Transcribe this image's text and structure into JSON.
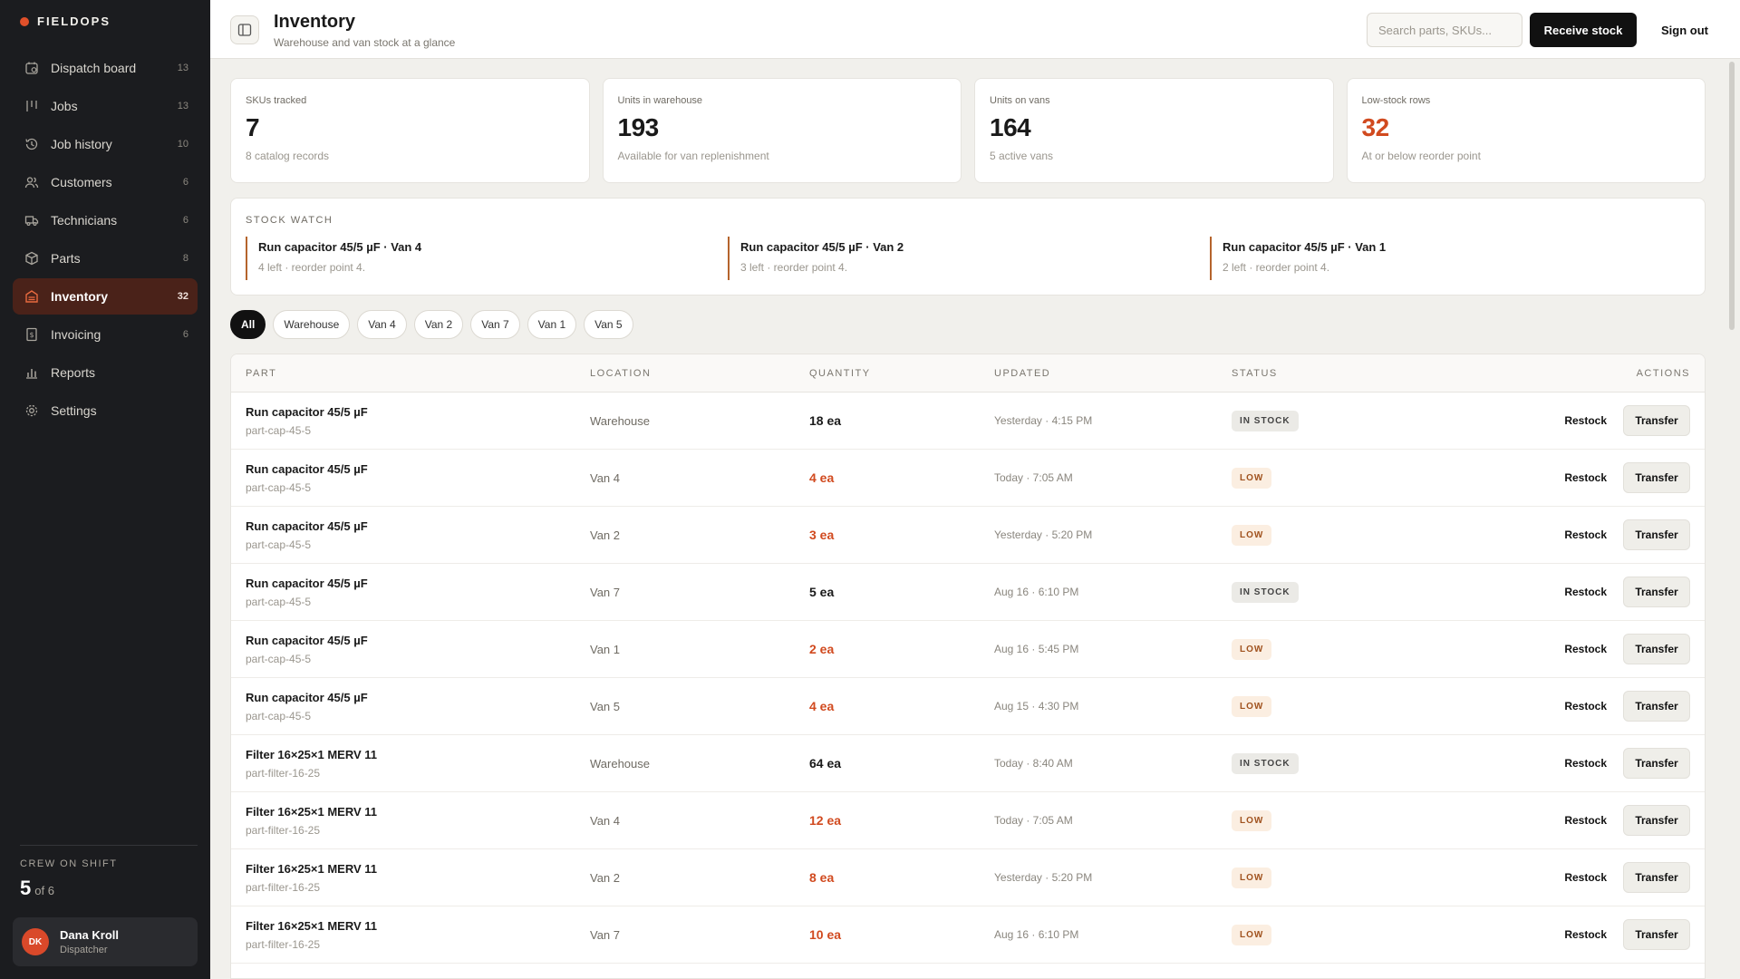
{
  "brand": {
    "name": "FIELDOPS"
  },
  "nav": [
    {
      "label": "Dispatch board",
      "count": "13",
      "icon": "dispatch-board-icon",
      "active": false
    },
    {
      "label": "Jobs",
      "count": "13",
      "icon": "jobs-icon",
      "active": false
    },
    {
      "label": "Job history",
      "count": "10",
      "icon": "history-icon",
      "active": false
    },
    {
      "label": "Customers",
      "count": "6",
      "icon": "customers-icon",
      "active": false
    },
    {
      "label": "Technicians",
      "count": "6",
      "icon": "truck-icon",
      "active": false
    },
    {
      "label": "Parts",
      "count": "8",
      "icon": "box-icon",
      "active": false
    },
    {
      "label": "Inventory",
      "count": "32",
      "icon": "inventory-icon",
      "active": true
    },
    {
      "label": "Invoicing",
      "count": "6",
      "icon": "invoice-icon",
      "active": false
    },
    {
      "label": "Reports",
      "count": "",
      "icon": "bar-chart-icon",
      "active": false
    },
    {
      "label": "Settings",
      "count": "",
      "icon": "gear-icon",
      "active": false
    }
  ],
  "crew": {
    "label": "CREW ON SHIFT",
    "on": "5",
    "total": "of 6"
  },
  "user": {
    "initials": "DK",
    "name": "Dana Kroll",
    "role": "Dispatcher"
  },
  "header": {
    "title": "Inventory",
    "subtitle": "Warehouse and van stock at a glance",
    "search_placeholder": "Search parts, SKUs...",
    "primary_label": "Receive stock",
    "signout_label": "Sign out"
  },
  "stats": [
    {
      "label": "SKUs tracked",
      "value": "7",
      "note": "8 catalog records",
      "alert": false
    },
    {
      "label": "Units in warehouse",
      "value": "193",
      "note": "Available for van replenishment",
      "alert": false
    },
    {
      "label": "Units on vans",
      "value": "164",
      "note": "5 active vans",
      "alert": false
    },
    {
      "label": "Low-stock rows",
      "value": "32",
      "note": "At or below reorder point",
      "alert": true
    }
  ],
  "watch": {
    "title": "STOCK WATCH",
    "items": [
      {
        "title": "Run capacitor 45/5 µF · Van 4",
        "note": "4 left · reorder point 4."
      },
      {
        "title": "Run capacitor 45/5 µF · Van 2",
        "note": "3 left · reorder point 4."
      },
      {
        "title": "Run capacitor 45/5 µF · Van 1",
        "note": "2 left · reorder point 4."
      }
    ]
  },
  "filters": [
    {
      "label": "All",
      "active": true
    },
    {
      "label": "Warehouse",
      "active": false
    },
    {
      "label": "Van 4",
      "active": false
    },
    {
      "label": "Van 2",
      "active": false
    },
    {
      "label": "Van 7",
      "active": false
    },
    {
      "label": "Van 1",
      "active": false
    },
    {
      "label": "Van 5",
      "active": false
    }
  ],
  "table": {
    "columns": {
      "part": "PART",
      "location": "LOCATION",
      "quantity": "QUANTITY",
      "updated": "UPDATED",
      "status": "STATUS",
      "actions": "ACTIONS"
    },
    "restock_label": "Restock",
    "transfer_label": "Transfer",
    "rows": [
      {
        "part": "Run capacitor 45/5 µF",
        "sku": "part-cap-45-5",
        "location": "Warehouse",
        "qty": "18 ea",
        "updated": "Yesterday · 4:15 PM",
        "status": "IN STOCK",
        "low": false
      },
      {
        "part": "Run capacitor 45/5 µF",
        "sku": "part-cap-45-5",
        "location": "Van 4",
        "qty": "4 ea",
        "updated": "Today · 7:05 AM",
        "status": "LOW",
        "low": true
      },
      {
        "part": "Run capacitor 45/5 µF",
        "sku": "part-cap-45-5",
        "location": "Van 2",
        "qty": "3 ea",
        "updated": "Yesterday · 5:20 PM",
        "status": "LOW",
        "low": true
      },
      {
        "part": "Run capacitor 45/5 µF",
        "sku": "part-cap-45-5",
        "location": "Van 7",
        "qty": "5 ea",
        "updated": "Aug 16 · 6:10 PM",
        "status": "IN STOCK",
        "low": false
      },
      {
        "part": "Run capacitor 45/5 µF",
        "sku": "part-cap-45-5",
        "location": "Van 1",
        "qty": "2 ea",
        "updated": "Aug 16 · 5:45 PM",
        "status": "LOW",
        "low": true
      },
      {
        "part": "Run capacitor 45/5 µF",
        "sku": "part-cap-45-5",
        "location": "Van 5",
        "qty": "4 ea",
        "updated": "Aug 15 · 4:30 PM",
        "status": "LOW",
        "low": true
      },
      {
        "part": "Filter 16×25×1 MERV 11",
        "sku": "part-filter-16-25",
        "location": "Warehouse",
        "qty": "64 ea",
        "updated": "Today · 8:40 AM",
        "status": "IN STOCK",
        "low": false
      },
      {
        "part": "Filter 16×25×1 MERV 11",
        "sku": "part-filter-16-25",
        "location": "Van 4",
        "qty": "12 ea",
        "updated": "Today · 7:05 AM",
        "status": "LOW",
        "low": true
      },
      {
        "part": "Filter 16×25×1 MERV 11",
        "sku": "part-filter-16-25",
        "location": "Van 2",
        "qty": "8 ea",
        "updated": "Yesterday · 5:20 PM",
        "status": "LOW",
        "low": true
      },
      {
        "part": "Filter 16×25×1 MERV 11",
        "sku": "part-filter-16-25",
        "location": "Van 7",
        "qty": "10 ea",
        "updated": "Aug 16 · 6:10 PM",
        "status": "LOW",
        "low": true
      }
    ]
  }
}
